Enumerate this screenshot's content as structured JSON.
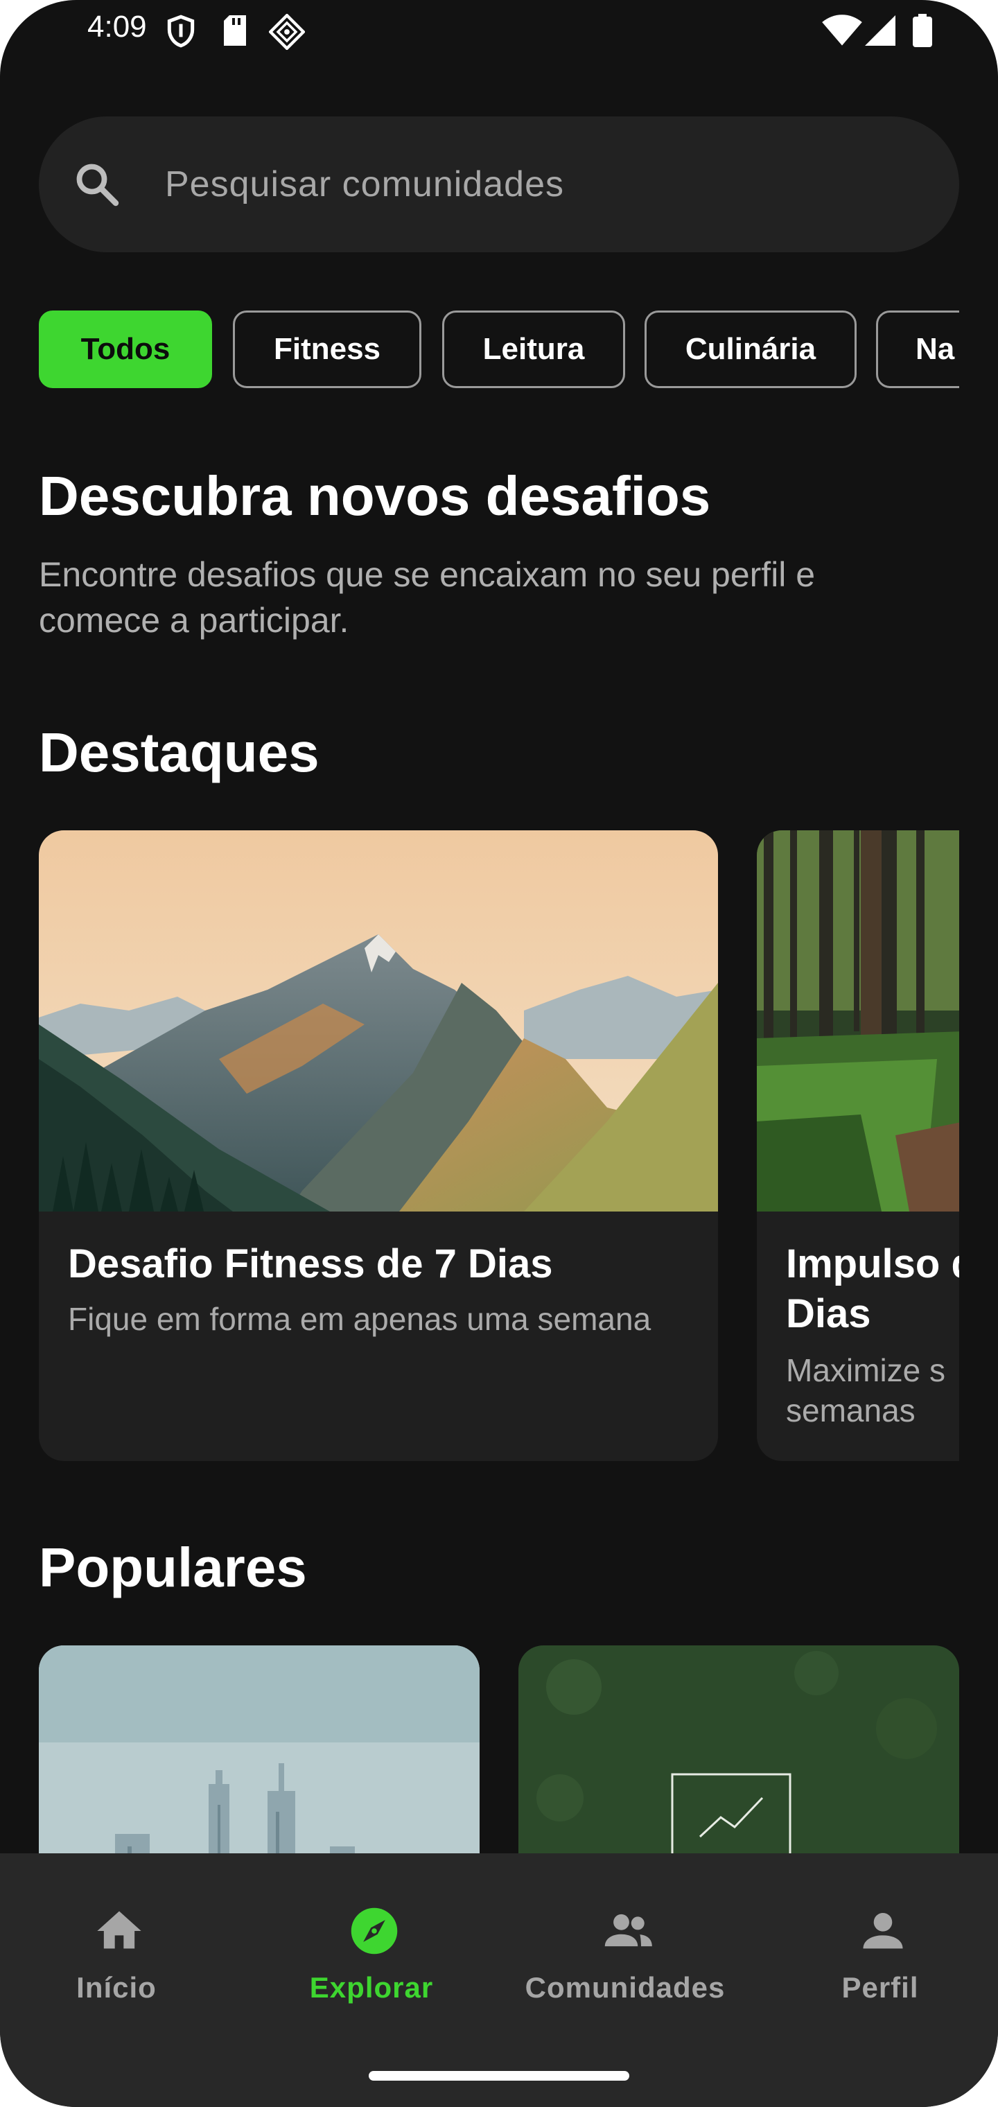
{
  "status_bar": {
    "time": "4:09",
    "icons": [
      "shield-icon",
      "sd-card-icon",
      "app-notification-icon",
      "wifi-icon",
      "signal-icon",
      "battery-icon"
    ]
  },
  "search": {
    "placeholder": "Pesquisar comunidades",
    "value": "",
    "icon": "search-icon"
  },
  "chips": [
    {
      "label": "Todos",
      "selected": true
    },
    {
      "label": "Fitness",
      "selected": false
    },
    {
      "label": "Leitura",
      "selected": false
    },
    {
      "label": "Culinária",
      "selected": false
    },
    {
      "label": "Na",
      "selected": false
    }
  ],
  "discover": {
    "title": "Descubra novos desafios",
    "subtitle_line1": "Encontre desafios que se encaixam no seu perfil e",
    "subtitle_line2": "comece a participar."
  },
  "featured": {
    "title": "Destaques",
    "cards": [
      {
        "title": "Desafio Fitness de 7 Dias",
        "description": "Fique em forma em apenas uma semana",
        "image": "mountain-landscape"
      },
      {
        "title_line1": "Impulso d",
        "title_line2": "Dias",
        "description_line1": "Maximize s",
        "description_line2": "semanas",
        "image": "forest-path"
      }
    ]
  },
  "popular": {
    "title": "Populares",
    "cards": [
      {
        "image": "city-skyline"
      },
      {
        "image": "growth-chart"
      }
    ]
  },
  "bottom_nav": {
    "items": [
      {
        "label": "Início",
        "icon": "home-icon",
        "active": false
      },
      {
        "label": "Explorar",
        "icon": "compass-icon",
        "active": true
      },
      {
        "label": "Comunidades",
        "icon": "group-icon",
        "active": false
      },
      {
        "label": "Perfil",
        "icon": "person-icon",
        "active": false
      }
    ]
  },
  "colors": {
    "background": "#121212",
    "accent": "#3ed630",
    "card": "#1f1f1f",
    "nav": "#282828",
    "muted_text": "#ababab"
  }
}
